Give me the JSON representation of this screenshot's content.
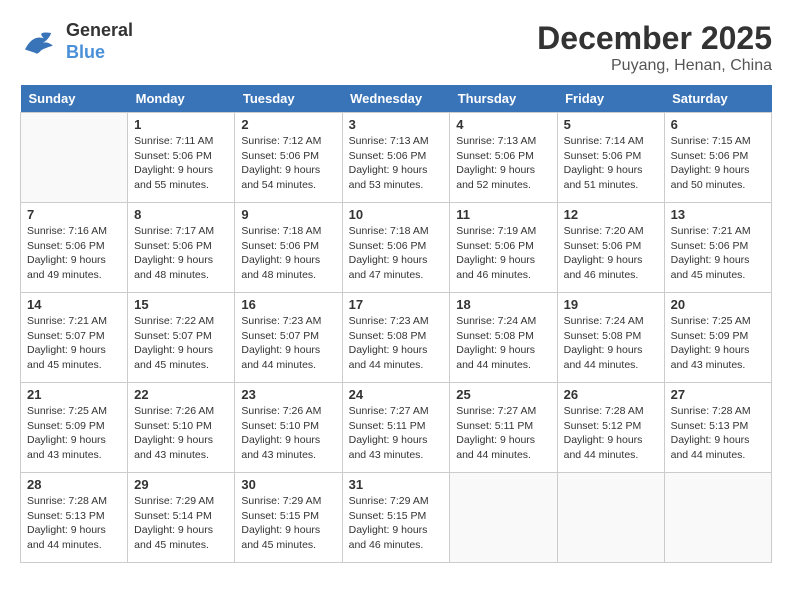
{
  "header": {
    "logo_line1": "General",
    "logo_line2": "Blue",
    "month_year": "December 2025",
    "location": "Puyang, Henan, China"
  },
  "days_of_week": [
    "Sunday",
    "Monday",
    "Tuesday",
    "Wednesday",
    "Thursday",
    "Friday",
    "Saturday"
  ],
  "weeks": [
    [
      {
        "day": "",
        "info": ""
      },
      {
        "day": "1",
        "info": "Sunrise: 7:11 AM\nSunset: 5:06 PM\nDaylight: 9 hours\nand 55 minutes."
      },
      {
        "day": "2",
        "info": "Sunrise: 7:12 AM\nSunset: 5:06 PM\nDaylight: 9 hours\nand 54 minutes."
      },
      {
        "day": "3",
        "info": "Sunrise: 7:13 AM\nSunset: 5:06 PM\nDaylight: 9 hours\nand 53 minutes."
      },
      {
        "day": "4",
        "info": "Sunrise: 7:13 AM\nSunset: 5:06 PM\nDaylight: 9 hours\nand 52 minutes."
      },
      {
        "day": "5",
        "info": "Sunrise: 7:14 AM\nSunset: 5:06 PM\nDaylight: 9 hours\nand 51 minutes."
      },
      {
        "day": "6",
        "info": "Sunrise: 7:15 AM\nSunset: 5:06 PM\nDaylight: 9 hours\nand 50 minutes."
      }
    ],
    [
      {
        "day": "7",
        "info": "Sunrise: 7:16 AM\nSunset: 5:06 PM\nDaylight: 9 hours\nand 49 minutes."
      },
      {
        "day": "8",
        "info": "Sunrise: 7:17 AM\nSunset: 5:06 PM\nDaylight: 9 hours\nand 48 minutes."
      },
      {
        "day": "9",
        "info": "Sunrise: 7:18 AM\nSunset: 5:06 PM\nDaylight: 9 hours\nand 48 minutes."
      },
      {
        "day": "10",
        "info": "Sunrise: 7:18 AM\nSunset: 5:06 PM\nDaylight: 9 hours\nand 47 minutes."
      },
      {
        "day": "11",
        "info": "Sunrise: 7:19 AM\nSunset: 5:06 PM\nDaylight: 9 hours\nand 46 minutes."
      },
      {
        "day": "12",
        "info": "Sunrise: 7:20 AM\nSunset: 5:06 PM\nDaylight: 9 hours\nand 46 minutes."
      },
      {
        "day": "13",
        "info": "Sunrise: 7:21 AM\nSunset: 5:06 PM\nDaylight: 9 hours\nand 45 minutes."
      }
    ],
    [
      {
        "day": "14",
        "info": "Sunrise: 7:21 AM\nSunset: 5:07 PM\nDaylight: 9 hours\nand 45 minutes."
      },
      {
        "day": "15",
        "info": "Sunrise: 7:22 AM\nSunset: 5:07 PM\nDaylight: 9 hours\nand 45 minutes."
      },
      {
        "day": "16",
        "info": "Sunrise: 7:23 AM\nSunset: 5:07 PM\nDaylight: 9 hours\nand 44 minutes."
      },
      {
        "day": "17",
        "info": "Sunrise: 7:23 AM\nSunset: 5:08 PM\nDaylight: 9 hours\nand 44 minutes."
      },
      {
        "day": "18",
        "info": "Sunrise: 7:24 AM\nSunset: 5:08 PM\nDaylight: 9 hours\nand 44 minutes."
      },
      {
        "day": "19",
        "info": "Sunrise: 7:24 AM\nSunset: 5:08 PM\nDaylight: 9 hours\nand 44 minutes."
      },
      {
        "day": "20",
        "info": "Sunrise: 7:25 AM\nSunset: 5:09 PM\nDaylight: 9 hours\nand 43 minutes."
      }
    ],
    [
      {
        "day": "21",
        "info": "Sunrise: 7:25 AM\nSunset: 5:09 PM\nDaylight: 9 hours\nand 43 minutes."
      },
      {
        "day": "22",
        "info": "Sunrise: 7:26 AM\nSunset: 5:10 PM\nDaylight: 9 hours\nand 43 minutes."
      },
      {
        "day": "23",
        "info": "Sunrise: 7:26 AM\nSunset: 5:10 PM\nDaylight: 9 hours\nand 43 minutes."
      },
      {
        "day": "24",
        "info": "Sunrise: 7:27 AM\nSunset: 5:11 PM\nDaylight: 9 hours\nand 43 minutes."
      },
      {
        "day": "25",
        "info": "Sunrise: 7:27 AM\nSunset: 5:11 PM\nDaylight: 9 hours\nand 44 minutes."
      },
      {
        "day": "26",
        "info": "Sunrise: 7:28 AM\nSunset: 5:12 PM\nDaylight: 9 hours\nand 44 minutes."
      },
      {
        "day": "27",
        "info": "Sunrise: 7:28 AM\nSunset: 5:13 PM\nDaylight: 9 hours\nand 44 minutes."
      }
    ],
    [
      {
        "day": "28",
        "info": "Sunrise: 7:28 AM\nSunset: 5:13 PM\nDaylight: 9 hours\nand 44 minutes."
      },
      {
        "day": "29",
        "info": "Sunrise: 7:29 AM\nSunset: 5:14 PM\nDaylight: 9 hours\nand 45 minutes."
      },
      {
        "day": "30",
        "info": "Sunrise: 7:29 AM\nSunset: 5:15 PM\nDaylight: 9 hours\nand 45 minutes."
      },
      {
        "day": "31",
        "info": "Sunrise: 7:29 AM\nSunset: 5:15 PM\nDaylight: 9 hours\nand 46 minutes."
      },
      {
        "day": "",
        "info": ""
      },
      {
        "day": "",
        "info": ""
      },
      {
        "day": "",
        "info": ""
      }
    ]
  ]
}
